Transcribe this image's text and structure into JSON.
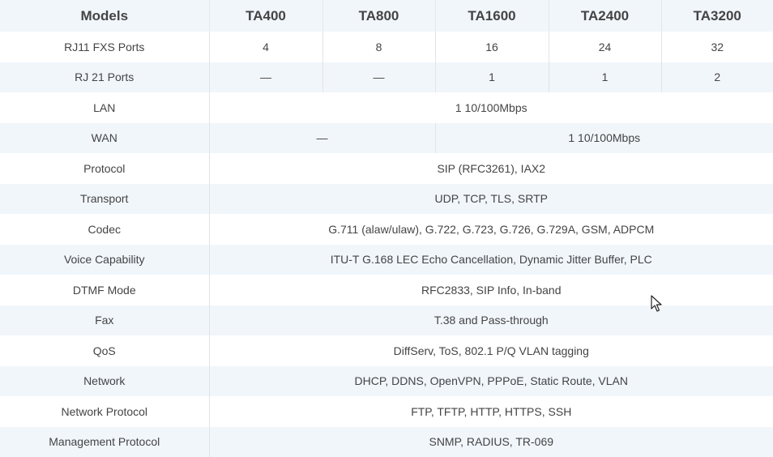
{
  "header": {
    "models_label": "Models",
    "models": [
      "TA400",
      "TA800",
      "TA1600",
      "TA2400",
      "TA3200"
    ]
  },
  "rows": {
    "rj11": {
      "label": "RJ11 FXS Ports",
      "values": [
        "4",
        "8",
        "16",
        "24",
        "32"
      ]
    },
    "rj21": {
      "label": "RJ 21 Ports",
      "values": [
        "—",
        "—",
        "1",
        "1",
        "2"
      ]
    },
    "lan": {
      "label": "LAN",
      "value": "1 10/100Mbps"
    },
    "wan": {
      "label": "WAN",
      "left_value": "—",
      "right_value": "1 10/100Mbps"
    },
    "protocol": {
      "label": "Protocol",
      "value": "SIP (RFC3261), IAX2"
    },
    "transport": {
      "label": "Transport",
      "value": "UDP, TCP, TLS, SRTP"
    },
    "codec": {
      "label": "Codec",
      "value": "G.711 (alaw/ulaw), G.722, G.723, G.726, G.729A, GSM, ADPCM"
    },
    "voice": {
      "label": "Voice Capability",
      "value": "ITU-T G.168 LEC Echo Cancellation, Dynamic Jitter Buffer, PLC"
    },
    "dtmf": {
      "label": "DTMF Mode",
      "value": "RFC2833, SIP Info, In-band"
    },
    "fax": {
      "label": "Fax",
      "value": "T.38 and Pass-through"
    },
    "qos": {
      "label": "QoS",
      "value": "DiffServ, ToS, 802.1 P/Q VLAN tagging"
    },
    "network": {
      "label": "Network",
      "value": "DHCP, DDNS, OpenVPN, PPPoE, Static Route, VLAN"
    },
    "netproto": {
      "label": "Network Protocol",
      "value": "FTP, TFTP, HTTP, HTTPS, SSH"
    },
    "mgmt": {
      "label": "Management Protocol",
      "value": "SNMP, RADIUS, TR-069"
    }
  },
  "colors": {
    "header_bg": "#f1f6fb",
    "stripe_bg": "#f1f6fb",
    "text": "#444444",
    "grid_line": "#e3e3e3"
  },
  "cursor_icon": "mouse-pointer-icon"
}
